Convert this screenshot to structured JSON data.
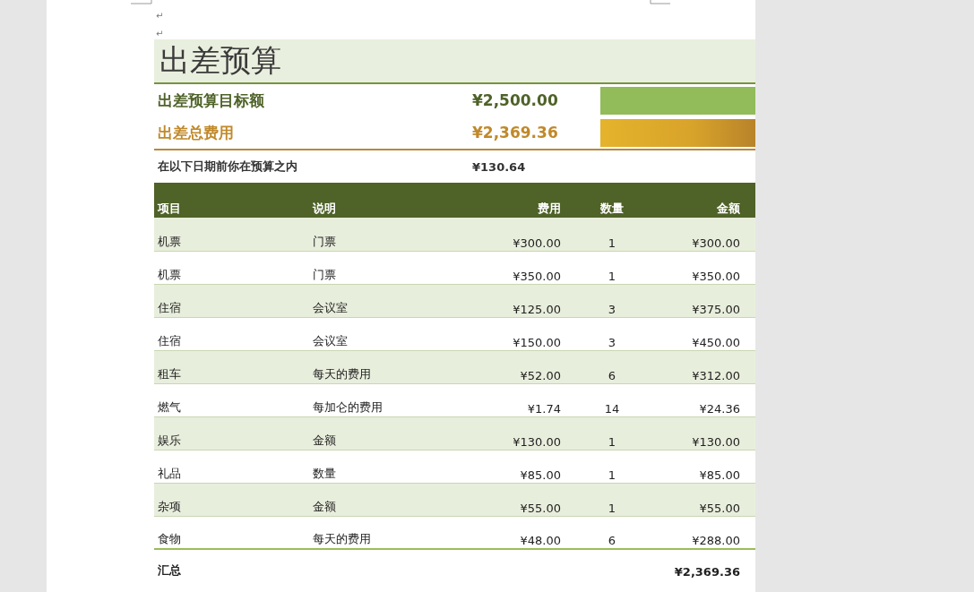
{
  "paragraph_marks": [
    "↵",
    "↵"
  ],
  "title": "出差预算",
  "summary": [
    {
      "kind": "target",
      "label": "出差预算目标额",
      "value": "¥2,500.00"
    },
    {
      "kind": "spent",
      "label": "出差总费用",
      "value": "¥2,369.36"
    },
    {
      "kind": "remaining",
      "label": "在以下日期前你在预算之内",
      "value": "¥130.64"
    }
  ],
  "table": {
    "columns": [
      "项目",
      "说明",
      "费用",
      "数量",
      "金额"
    ],
    "rows": [
      [
        "机票",
        "门票",
        "¥300.00",
        "1",
        "¥300.00"
      ],
      [
        "机票",
        "门票",
        "¥350.00",
        "1",
        "¥350.00"
      ],
      [
        "住宿",
        "会议室",
        "¥125.00",
        "3",
        "¥375.00"
      ],
      [
        "住宿",
        "会议室",
        "¥150.00",
        "3",
        "¥450.00"
      ],
      [
        "租车",
        "每天的费用",
        "¥52.00",
        "6",
        "¥312.00"
      ],
      [
        "燃气",
        "每加仑的费用",
        "¥1.74",
        "14",
        "¥24.36"
      ],
      [
        "娱乐",
        "金额",
        "¥130.00",
        "1",
        "¥130.00"
      ],
      [
        "礼品",
        "数量",
        "¥85.00",
        "1",
        "¥85.00"
      ],
      [
        "杂项",
        "金额",
        "¥55.00",
        "1",
        "¥55.00"
      ],
      [
        "食物",
        "每天的费用",
        "¥48.00",
        "6",
        "¥288.00"
      ]
    ],
    "total": {
      "label": "汇总",
      "value": "¥2,369.36"
    }
  }
}
